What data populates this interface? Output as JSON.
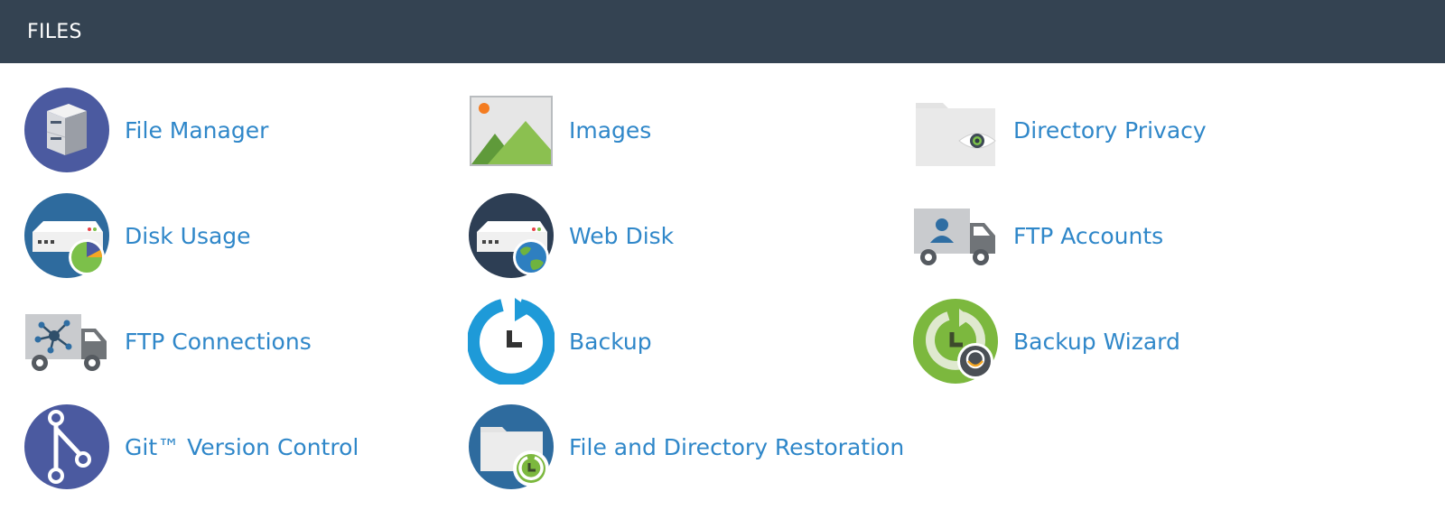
{
  "header": {
    "title": "FILES"
  },
  "items": [
    {
      "label": "File Manager",
      "icon": "file-manager-icon"
    },
    {
      "label": "Images",
      "icon": "images-icon"
    },
    {
      "label": "Directory Privacy",
      "icon": "directory-privacy-icon"
    },
    {
      "label": "Disk Usage",
      "icon": "disk-usage-icon"
    },
    {
      "label": "Web Disk",
      "icon": "web-disk-icon"
    },
    {
      "label": "FTP Accounts",
      "icon": "ftp-accounts-icon"
    },
    {
      "label": "FTP Connections",
      "icon": "ftp-connections-icon"
    },
    {
      "label": "Backup",
      "icon": "backup-icon"
    },
    {
      "label": "Backup Wizard",
      "icon": "backup-wizard-icon"
    },
    {
      "label": "Git™ Version Control",
      "icon": "git-version-control-icon"
    },
    {
      "label": "File and Directory Restoration",
      "icon": "file-directory-restoration-icon"
    }
  ],
  "colors": {
    "header_bg": "#344352",
    "link": "#2f87c9"
  }
}
